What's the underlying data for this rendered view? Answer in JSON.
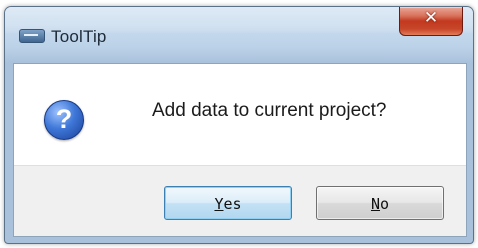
{
  "window": {
    "title": "ToolTip",
    "close_glyph": "✕"
  },
  "dialog": {
    "icon": "question-icon",
    "icon_glyph": "?",
    "message": "Add data to current project?"
  },
  "buttons": {
    "yes_mnemonic": "Y",
    "yes_rest": "es",
    "no_mnemonic": "N",
    "no_rest": "o"
  }
}
